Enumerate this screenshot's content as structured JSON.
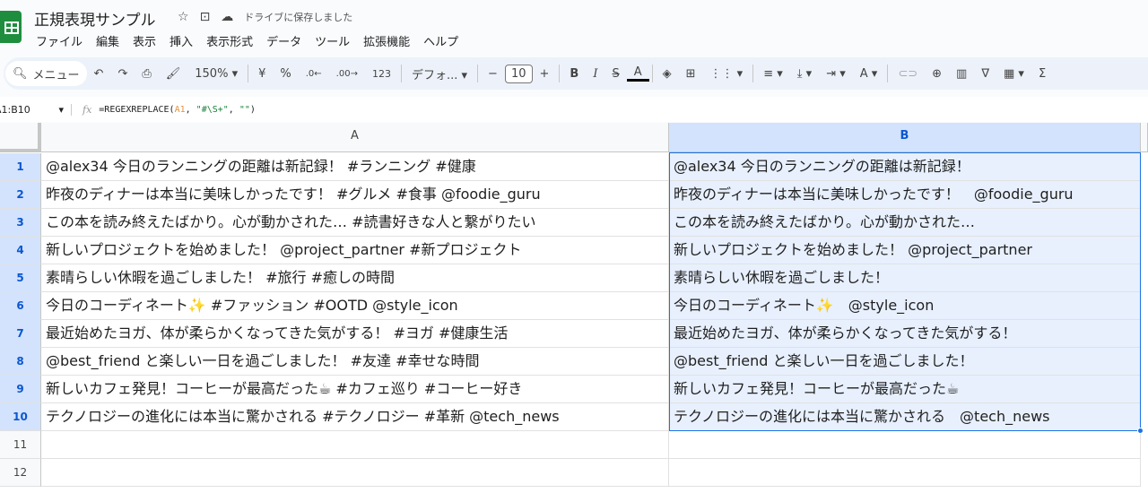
{
  "app": {
    "title": "正規表現サンプル",
    "save_status": "ドライブに保存しました",
    "icons": [
      "star-icon",
      "folder-move-icon",
      "cloud-saved-icon"
    ]
  },
  "menu": [
    "ファイル",
    "編集",
    "表示",
    "挿入",
    "表示形式",
    "データ",
    "ツール",
    "拡張機能",
    "ヘルプ"
  ],
  "toolbar": {
    "search": "メニュー",
    "zoom": "150%",
    "currency": "¥",
    "percent": "%",
    "dec_less": ".0←",
    "dec_more": ".00→",
    "format_num": "123",
    "font": "デフォ...",
    "font_size": "10",
    "bold": "B",
    "italic": "I",
    "strike": "S",
    "text_color": "A",
    "sigma": "Σ"
  },
  "formula_bar": {
    "name_box": "A1:B10",
    "fx": "fx",
    "formula_prefix": "=REGEXREPLACE(",
    "formula_ref": "A1",
    "formula_mid": ", ",
    "formula_pattern": "\"#\\S+\"",
    "formula_sep": ", ",
    "formula_repl": "\"\"",
    "formula_suffix": ")"
  },
  "columns": [
    "A",
    "B"
  ],
  "selection_color": "#1a73e8",
  "rows": [
    {
      "n": "1",
      "a": "@alex34 今日のランニングの距離は新記録！ #ランニング #健康",
      "b": "@alex34 今日のランニングの距離は新記録！"
    },
    {
      "n": "2",
      "a": "昨夜のディナーは本当に美味しかったです！ #グルメ #食事 @foodie_guru",
      "b": "昨夜のディナーは本当に美味しかったです！　@foodie_guru"
    },
    {
      "n": "3",
      "a": "この本を読み終えたばかり。心が動かされた… #読書好きな人と繋がりたい",
      "b": "この本を読み終えたばかり。心が動かされた…"
    },
    {
      "n": "4",
      "a": "新しいプロジェクトを始めました！ @project_partner #新プロジェクト",
      "b": "新しいプロジェクトを始めました！ @project_partner"
    },
    {
      "n": "5",
      "a": "素晴らしい休暇を過ごしました！ #旅行 #癒しの時間",
      "b": "素晴らしい休暇を過ごしました！"
    },
    {
      "n": "6",
      "a": "今日のコーディネート✨ #ファッション #OOTD @style_icon",
      "b": "今日のコーディネート✨　@style_icon"
    },
    {
      "n": "7",
      "a": "最近始めたヨガ、体が柔らかくなってきた気がする！ #ヨガ #健康生活",
      "b": "最近始めたヨガ、体が柔らかくなってきた気がする！"
    },
    {
      "n": "8",
      "a": "@best_friend と楽しい一日を過ごしました！ #友達 #幸せな時間",
      "b": "@best_friend と楽しい一日を過ごしました！"
    },
    {
      "n": "9",
      "a": "新しいカフェ発見！コーヒーが最高だった☕ #カフェ巡り #コーヒー好き",
      "b": "新しいカフェ発見！コーヒーが最高だった☕"
    },
    {
      "n": "10",
      "a": "テクノロジーの進化には本当に驚かされる #テクノロジー #革新 @tech_news",
      "b": "テクノロジーの進化には本当に驚かされる　@tech_news"
    },
    {
      "n": "11",
      "a": "",
      "b": ""
    },
    {
      "n": "12",
      "a": "",
      "b": ""
    }
  ]
}
